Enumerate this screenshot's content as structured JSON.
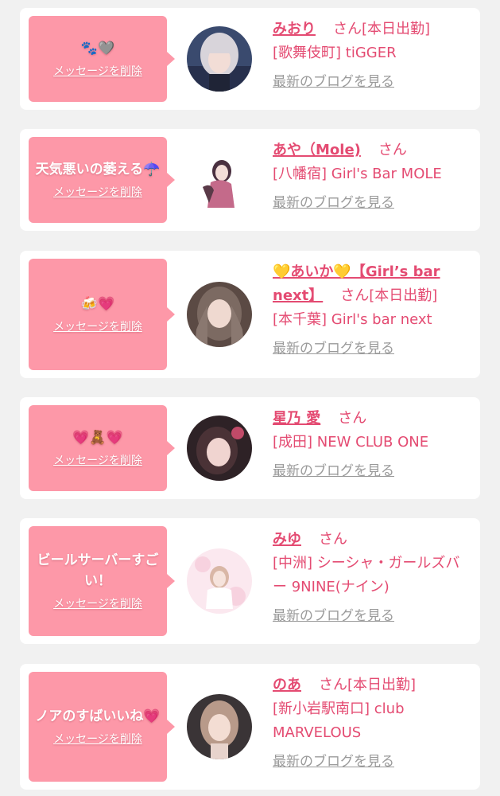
{
  "delete_label": "メッセージを削除",
  "blog_label": "最新のブログを見る",
  "honorific": "さん",
  "colors": {
    "accent": "#e44b72",
    "bubble": "#fd98a8",
    "link_gray": "#9a9a9a",
    "background": "#f1f1f1"
  },
  "entries": [
    {
      "message": "🐾🩶",
      "name": "みおり",
      "status": "[本日出勤]",
      "shop": "[歌舞伎町] tiGGER"
    },
    {
      "message": "天気悪いの萎える☂️",
      "name": "あや（Mole)",
      "status": "",
      "shop": "[八幡宿] Girl's Bar MOLE"
    },
    {
      "message": "🍻💗",
      "name": "💛あいか💛【Girl’s bar next】",
      "status": "[本日出勤]",
      "shop": "[本千葉] Girl's bar next"
    },
    {
      "message": "💗🧸💗",
      "name": "星乃 愛",
      "status": "",
      "shop": "[成田] NEW CLUB ONE"
    },
    {
      "message": "ビールサーバーすごい！",
      "name": "みゆ",
      "status": "",
      "shop": "[中洲] シーシャ・ガールズバー 9NINE(ナイン)"
    },
    {
      "message": "ノアのすばいいね💗",
      "name": "のあ",
      "status": "[本日出勤]",
      "shop": "[新小岩駅南口] club MARVELOUS"
    }
  ]
}
